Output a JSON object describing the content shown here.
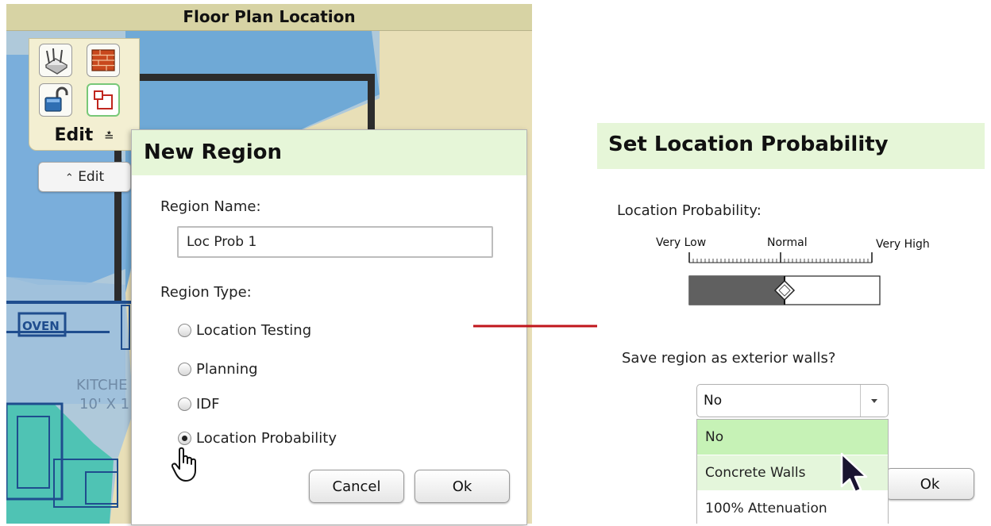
{
  "floor_plan": {
    "title": "Floor Plan Location",
    "edit_label": "Edit",
    "edit_button_label": "Edit",
    "map_labels": {
      "oven": "OVEN",
      "kitchen": "KITCHE",
      "kitchen_dims": "10' X 1"
    }
  },
  "new_region": {
    "title": "New Region",
    "name_label": "Region Name:",
    "name_value": "Loc Prob 1",
    "type_label": "Region Type:",
    "types": [
      {
        "label": "Location Testing",
        "checked": false
      },
      {
        "label": "Planning",
        "checked": false
      },
      {
        "label": "IDF",
        "checked": false
      },
      {
        "label": "Location Probability",
        "checked": true
      }
    ],
    "cancel_label": "Cancel",
    "ok_label": "Ok"
  },
  "location_probability": {
    "title": "Set Location Probability",
    "label": "Location Probability:",
    "scale": {
      "low": "Very Low",
      "mid": "Normal",
      "high": "Very High"
    },
    "value_fraction": 0.5,
    "exterior_question": "Save region as exterior walls?",
    "exterior_selected": "No",
    "exterior_options": [
      {
        "label": "No",
        "highlight": "selected"
      },
      {
        "label": "Concrete Walls",
        "highlight": "hover"
      },
      {
        "label": "100% Attenuation",
        "highlight": "none"
      }
    ],
    "ok_label": "Ok"
  },
  "colors": {
    "dialog_title_bg": "#e6f6d8",
    "header_bg": "#d7d3a4",
    "arrow": "#c0161c",
    "slider_fill": "#606060",
    "dropdown_selected": "#c6f2b6",
    "dropdown_hover": "#e4f6db"
  }
}
